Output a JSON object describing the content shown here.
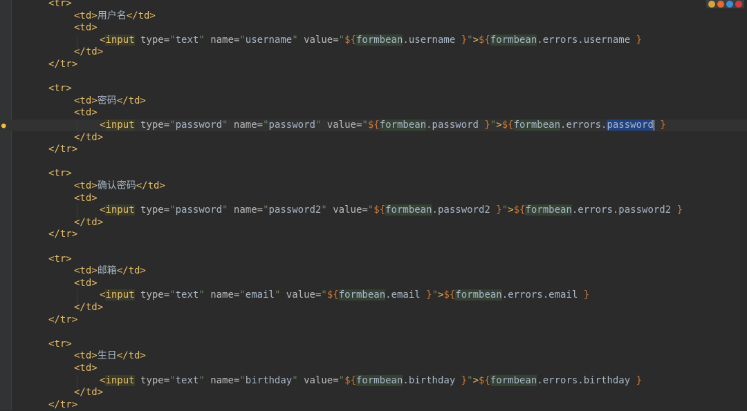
{
  "editor": {
    "lines": [
      {
        "text": "<tr>"
      },
      {
        "text": "<td>用户名</td>"
      },
      {
        "text": "<td>"
      },
      {
        "text": "<input type=\"text\" name=\"username\" value=\"${formbean.username }\">${formbean.errors.username }"
      },
      {
        "text": "</td>"
      },
      {
        "text": "</tr>"
      },
      {
        "text": ""
      },
      {
        "text": "<tr>"
      },
      {
        "text": "<td>密码</td>"
      },
      {
        "text": "<td>"
      },
      {
        "text": "<input type=\"password\" name=\"password\" value=\"${formbean.password }\">${formbean.errors.password }"
      },
      {
        "text": "</td>"
      },
      {
        "text": "</tr>"
      },
      {
        "text": ""
      },
      {
        "text": "<tr>"
      },
      {
        "text": "<td>确认密码</td>"
      },
      {
        "text": "<td>"
      },
      {
        "text": "<input type=\"password\" name=\"password2\" value=\"${formbean.password2 }\">${formbean.errors.password2 }"
      },
      {
        "text": "</td>"
      },
      {
        "text": "</tr>"
      },
      {
        "text": ""
      },
      {
        "text": "<tr>"
      },
      {
        "text": "<td>邮箱</td>"
      },
      {
        "text": "<td>"
      },
      {
        "text": "<input type=\"text\" name=\"email\" value=\"${formbean.email }\">${formbean.errors.email }"
      },
      {
        "text": "</td>"
      },
      {
        "text": "</tr>"
      },
      {
        "text": ""
      },
      {
        "text": "<tr>"
      },
      {
        "text": "<td>生日</td>"
      },
      {
        "text": "<td>"
      },
      {
        "text": "<input type=\"text\" name=\"birthday\" value=\"${formbean.birthday }\">${formbean.errors.birthday }"
      },
      {
        "text": "</td>"
      },
      {
        "text": "</tr>"
      }
    ],
    "selected_word": "password",
    "current_line": 10
  },
  "browser_icons": [
    {
      "name": "chrome-icon",
      "color": "#d9a53a"
    },
    {
      "name": "firefox-icon",
      "color": "#e36b2c"
    },
    {
      "name": "safari-icon",
      "color": "#3b8fd6"
    },
    {
      "name": "opera-icon",
      "color": "#d13b3b"
    }
  ],
  "colors": {
    "background": "#2b2b2b",
    "tag": "#e8bf6a",
    "string": "#6a8759",
    "el": "#cc7832",
    "selection": "#214283"
  }
}
